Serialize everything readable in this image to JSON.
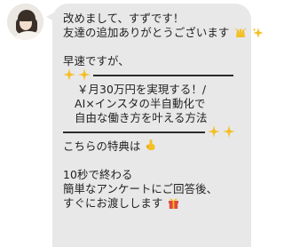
{
  "chat": {
    "avatar_label": "profile-photo",
    "message": {
      "line1": "改めまして、すずです！",
      "line2": "友達の追加ありがとうございます",
      "line3": "早速ですが、",
      "line4": "￥月30万円を実現する！/",
      "line5": "AI×インスタの半自動化で",
      "line6": "自由な働き方を叶える方法",
      "line7": "こちらの特典は",
      "line8": "10秒で終わる",
      "line9": "簡単なアンケートにご回答後、",
      "line10": "すぐにお渡しします"
    },
    "emoji": {
      "line2_end": [
        "raised-hands-icon",
        "sparkles-icon"
      ],
      "line3_rule_start": [
        "sparkle-star-icon",
        "sparkle-star-icon"
      ],
      "line6_rule_end": [
        "sparkle-star-icon",
        "sparkle-star-icon"
      ],
      "line7_end": [
        "pointing-down-icon"
      ],
      "line10_end": [
        "gift-icon"
      ]
    },
    "colors": {
      "bubble": "#e8e8e9",
      "text": "#1f1f1f",
      "emoji_yellow": "#f4c025",
      "gift_red": "#e2483d"
    }
  }
}
